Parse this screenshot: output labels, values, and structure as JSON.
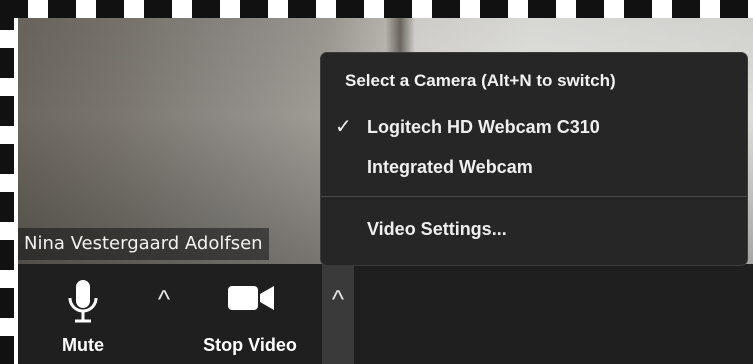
{
  "video": {
    "participant_name": "Nina Vestergaard Adolfsen"
  },
  "camera_menu": {
    "header": "Select a Camera (Alt+N to switch)",
    "items": [
      {
        "label": "Logitech HD Webcam C310",
        "checked": true
      },
      {
        "label": "Integrated Webcam",
        "checked": false
      }
    ],
    "settings_label": "Video Settings...",
    "check_mark": "✓"
  },
  "toolbar": {
    "mute_label": "Mute",
    "stop_video_label": "Stop Video",
    "caret": "^"
  },
  "colors": {
    "toolbar_bg": "#1f1f1f",
    "menu_bg": "#262626",
    "text": "#ffffff"
  }
}
